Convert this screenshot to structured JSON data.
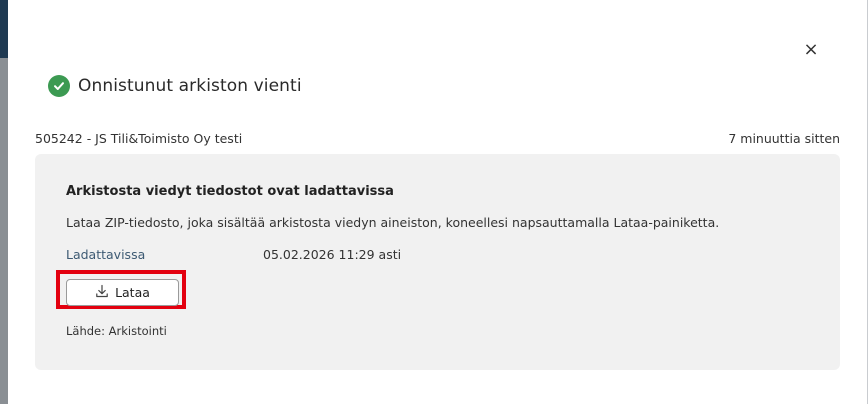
{
  "dialog": {
    "close_symbol": "×",
    "title": "Onnistunut arkiston vienti",
    "meta": {
      "left": "505242 - JS Tili&Toimisto Oy testi",
      "right": "7 minuuttia sitten"
    },
    "card": {
      "title": "Arkistosta viedyt tiedostot ovat ladattavissa",
      "description": "Lataa ZIP-tiedosto, joka sisältää arkistosta viedyn aineiston, koneellesi napsauttamalla Lataa-painiketta.",
      "availability_label": "Ladattavissa",
      "availability_value": "05.02.2026 11:29 asti",
      "download_label": "Lataa",
      "source": "Lähde: Arkistointi"
    }
  },
  "colors": {
    "success": "#3c9a52",
    "highlight": "#e3000f",
    "link": "#3d5a73",
    "card_bg": "#f1f1f1"
  },
  "icons": {
    "success": "check-circle-icon",
    "download": "download-icon",
    "close": "close-icon"
  }
}
